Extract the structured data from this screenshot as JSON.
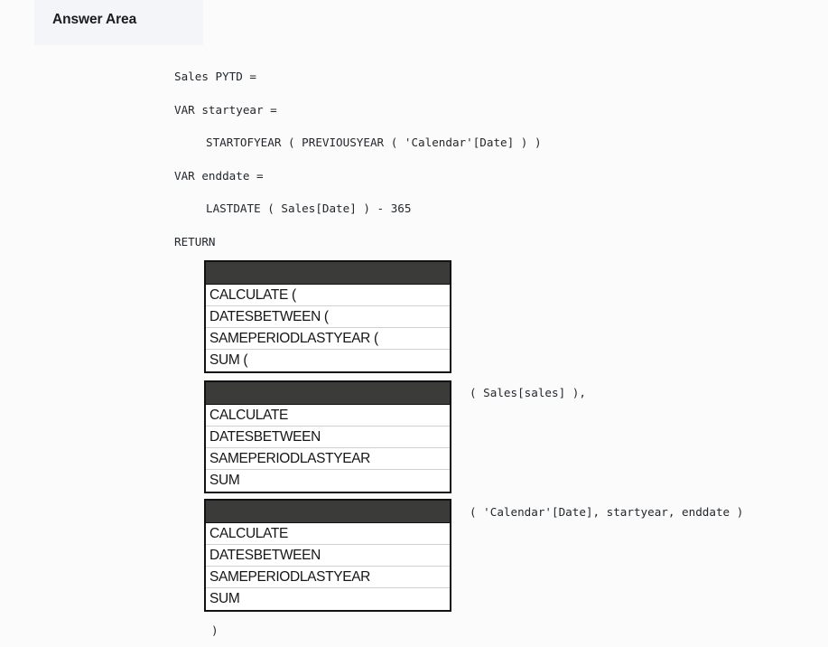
{
  "answer_area": {
    "title": "Answer Area",
    "panel_color": "#f4f5f8"
  },
  "code": {
    "lines": [
      {
        "text": "Sales PYTD =",
        "indent": false
      },
      {
        "text": "VAR startyear =",
        "indent": false
      },
      {
        "text": "STARTOFYEAR ( PREVIOUSYEAR ( 'Calendar'[Date] ) )",
        "indent": true
      },
      {
        "text": "VAR enddate =",
        "indent": false
      },
      {
        "text": "LASTDATE ( Sales[Date] ) - 365",
        "indent": true
      },
      {
        "text": "RETURN",
        "indent": false
      }
    ],
    "closing_paren": ")"
  },
  "dropdowns": [
    {
      "id": "dropdown-1",
      "selected": "",
      "options": [
        "CALCULATE (",
        "DATESBETWEEN (",
        "SAMEPERIODLASTYEAR (",
        "SUM ("
      ]
    },
    {
      "id": "dropdown-2",
      "selected": "",
      "options": [
        "CALCULATE",
        "DATESBETWEEN",
        "SAMEPERIODLASTYEAR",
        "SUM"
      ]
    },
    {
      "id": "dropdown-3",
      "selected": "",
      "options": [
        "CALCULATE",
        "DATESBETWEEN",
        "SAMEPERIODLASTYEAR",
        "SUM"
      ]
    }
  ],
  "inline_code": {
    "after_dropdown_2": "( Sales[sales] ),",
    "after_dropdown_3": "( 'Calendar'[Date], startyear, enddate )"
  },
  "colors": {
    "page_background": "#fbfbfc",
    "dropdown_header": "#3b3b39",
    "dropdown_border": "#121212",
    "option_divider": "#cfd0d1",
    "text": "#23272b"
  }
}
